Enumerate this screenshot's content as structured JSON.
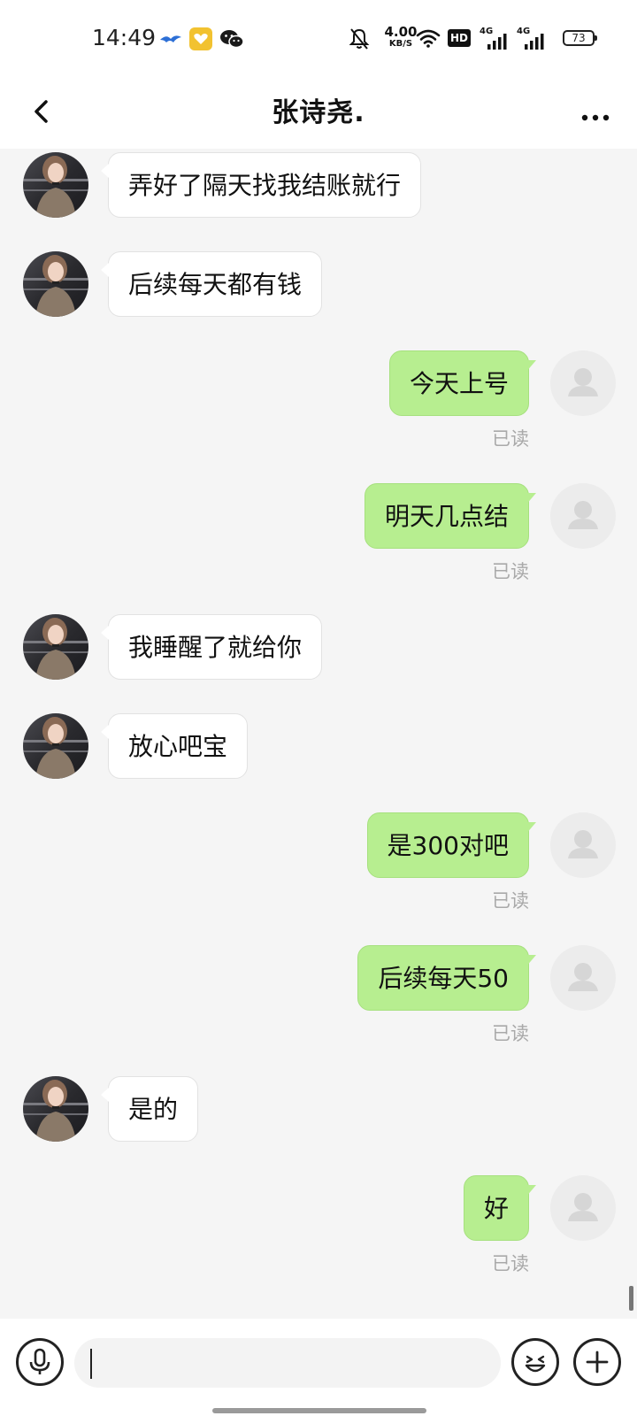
{
  "status_bar": {
    "time": "14:49",
    "net_speed_value": "4.00",
    "net_speed_unit": "KB/S",
    "hd_label": "HD",
    "signal_1": "4G",
    "signal_2": "4G",
    "battery": "73",
    "icons": [
      "app-bird-icon",
      "app-heart-icon",
      "wechat-icon",
      "mute-bell-icon",
      "wifi-icon",
      "hd-icon",
      "signal-icon",
      "signal-icon",
      "battery-icon"
    ]
  },
  "header": {
    "title": "张诗尧.",
    "back_icon": "chevron-left-icon",
    "more_icon": "more-dots-icon"
  },
  "messages": [
    {
      "from": "peer",
      "text": "弄好了隔天找我结账就行"
    },
    {
      "from": "peer",
      "text": "后续每天都有钱"
    },
    {
      "from": "me",
      "text": "今天上号",
      "status": "已读"
    },
    {
      "from": "me",
      "text": "明天几点结",
      "status": "已读"
    },
    {
      "from": "peer",
      "text": "我睡醒了就给你"
    },
    {
      "from": "peer",
      "text": "放心吧宝"
    },
    {
      "from": "me",
      "text": "是300对吧",
      "status": "已读"
    },
    {
      "from": "me",
      "text": "后续每天50",
      "status": "已读"
    },
    {
      "from": "peer",
      "text": "是的"
    },
    {
      "from": "me",
      "text": "好",
      "status": "已读"
    }
  ],
  "input": {
    "value": "",
    "voice_icon": "microphone-icon",
    "emoji_icon": "emoji-icon",
    "more_icon": "plus-icon"
  },
  "colors": {
    "outgoing_bubble": "#b7ee90",
    "incoming_bubble": "#ffffff",
    "chat_background": "#f5f5f5",
    "read_status": "#a9a9a9"
  }
}
